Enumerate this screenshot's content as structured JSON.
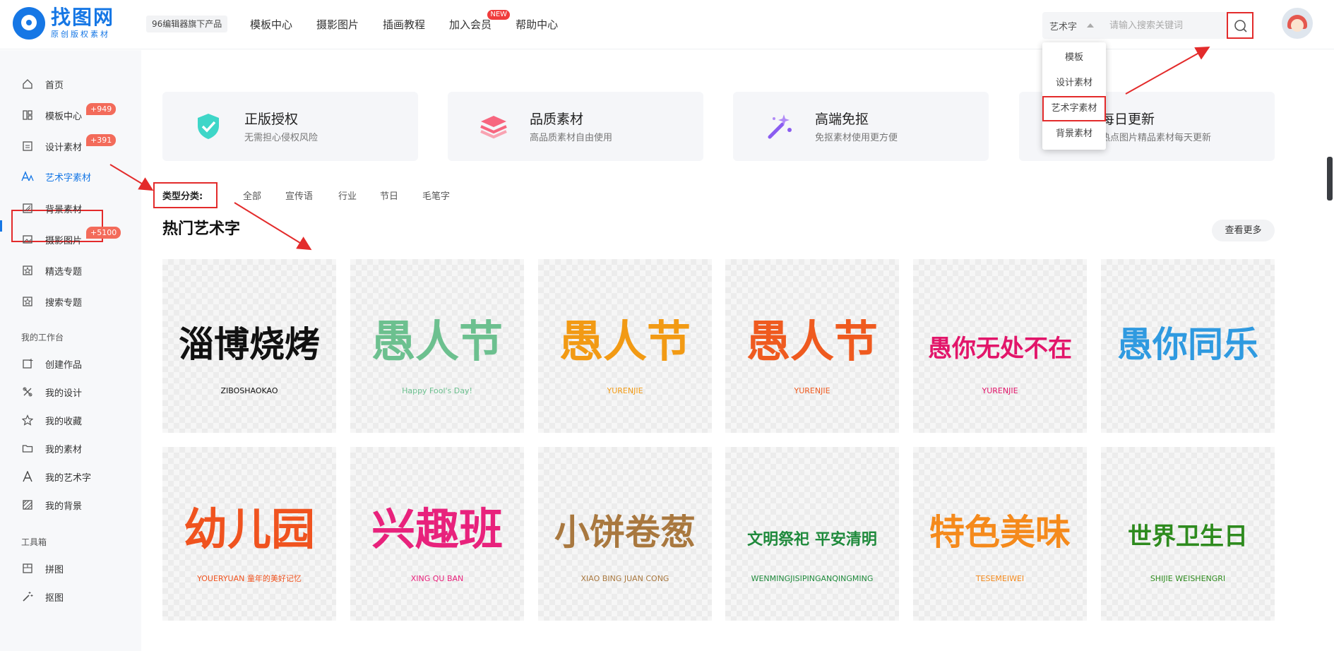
{
  "header": {
    "logo_name": "找图网",
    "logo_sub": "原创版权素材",
    "product_badge": "96编辑器旗下产品",
    "nav": [
      {
        "label": "模板中心"
      },
      {
        "label": "摄影图片"
      },
      {
        "label": "插画教程"
      },
      {
        "label": "加入会员",
        "badge": "NEW"
      },
      {
        "label": "帮助中心"
      }
    ],
    "search": {
      "type": "艺术字",
      "placeholder": "请输入搜索关键词"
    }
  },
  "search_dropdown": {
    "options": [
      "模板",
      "设计素材",
      "艺术字素材",
      "背景素材"
    ],
    "selected": "艺术字素材"
  },
  "sidebar": {
    "items": [
      {
        "label": "首页",
        "icon": "home-icon"
      },
      {
        "label": "模板中心",
        "icon": "template-icon",
        "badge": "+949"
      },
      {
        "label": "设计素材",
        "icon": "design-icon",
        "badge": "+391"
      },
      {
        "label": "艺术字素材",
        "icon": "font-icon",
        "active": true
      },
      {
        "label": "背景素材",
        "icon": "background-icon"
      },
      {
        "label": "摄影图片",
        "icon": "photo-icon",
        "badge": "+5100"
      },
      {
        "label": "精选专题",
        "icon": "topic-icon"
      },
      {
        "label": "搜索专题",
        "icon": "search-topic-icon"
      }
    ],
    "workspace_title": "我的工作台",
    "workspace": [
      {
        "label": "创建作品",
        "icon": "create-icon"
      },
      {
        "label": "我的设计",
        "icon": "my-design-icon"
      },
      {
        "label": "我的收藏",
        "icon": "star-icon"
      },
      {
        "label": "我的素材",
        "icon": "folder-icon"
      },
      {
        "label": "我的艺术字",
        "icon": "letter-a-icon"
      },
      {
        "label": "我的背景",
        "icon": "texture-icon"
      }
    ],
    "tools_title": "工具箱",
    "tools": [
      {
        "label": "拼图",
        "icon": "collage-icon"
      },
      {
        "label": "抠图",
        "icon": "magic-wand-icon"
      }
    ]
  },
  "features": [
    {
      "title": "正版授权",
      "desc": "无需担心侵权风险",
      "icon": "shield-check-icon",
      "color": "#3ed6c8"
    },
    {
      "title": "品质素材",
      "desc": "高品质素材自由使用",
      "icon": "layers-icon",
      "color": "#f7667f"
    },
    {
      "title": "高端免抠",
      "desc": "免抠素材使用更方便",
      "icon": "magic-wand-icon",
      "color": "#8a5cf0"
    },
    {
      "title": "每日更新",
      "desc": "热点图片精品素材每天更新",
      "icon": "calendar-icon",
      "color": "#3b8cf5"
    }
  ],
  "filter": {
    "label": "类型分类:",
    "options": [
      "全部",
      "宣传语",
      "行业",
      "节日",
      "毛笔字"
    ]
  },
  "section": {
    "title": "热门艺术字",
    "more": "查看更多"
  },
  "tiles": [
    {
      "main": "淄博烧烤",
      "sub": "ZIBOSHAOKAO",
      "color": "#111111"
    },
    {
      "main": "愚人节",
      "sub": "Happy Fool's Day!",
      "color": "#6cc08f"
    },
    {
      "main": "愚人节",
      "sub": "YURENJIE",
      "color": "#f29a14"
    },
    {
      "main": "愚人节",
      "sub": "YURENJIE",
      "color": "#ef5a1f"
    },
    {
      "main": "愚你无处不在",
      "sub": "YURENJIE",
      "color": "#e2156a"
    },
    {
      "main": "愚你同乐",
      "sub": "",
      "color": "#2f9ae0"
    },
    {
      "main": "幼儿园",
      "sub": "YOUERYUAN 童年的美好记忆",
      "color": "#f0531f"
    },
    {
      "main": "兴趣班",
      "sub": "XING QU BAN",
      "color": "#e8227c"
    },
    {
      "main": "小饼卷葱",
      "sub": "XIAO BING JUAN CONG",
      "color": "#a9783f"
    },
    {
      "main": "文明祭祀 平安清明",
      "sub": "WENMINGJISIPINGANQINGMING",
      "color": "#1f8a3c"
    },
    {
      "main": "特色美味",
      "sub": "TESEMEIWEI",
      "color": "#f58a1c"
    },
    {
      "main": "世界卫生日",
      "sub": "SHIJIE WEISHENGRI",
      "color": "#2e8b1e"
    }
  ]
}
